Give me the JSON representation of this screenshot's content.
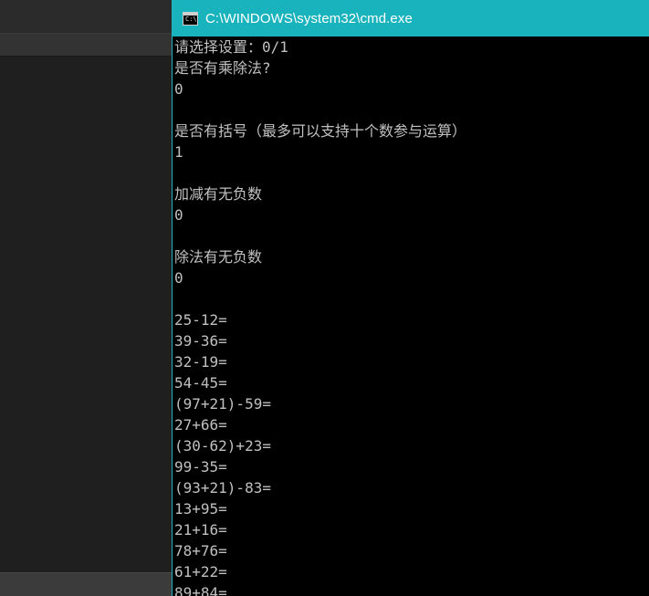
{
  "window": {
    "title": "C:\\WINDOWS\\system32\\cmd.exe",
    "icon": "cmd-console-icon",
    "icon_prompt": "C:\\"
  },
  "colors": {
    "titlebar": "#19b3bd",
    "console_bg": "#000000",
    "console_text": "#c0c0c0",
    "editor_bg": "#1f1f1f"
  },
  "console": {
    "lines": [
      "请选择设置：0/1",
      "是否有乘除法?",
      "0",
      "",
      "是否有括号（最多可以支持十个数参与运算）",
      "1",
      "",
      "加减有无负数",
      "0",
      "",
      "除法有无负数",
      "0",
      "",
      "25-12=",
      "39-36=",
      "32-19=",
      "54-45=",
      "(97+21)-59=",
      "27+66=",
      "(30-62)+23=",
      "99-35=",
      "(93+21)-83=",
      "13+95=",
      "21+16=",
      "78+76=",
      "61+22=",
      "89+84="
    ]
  }
}
